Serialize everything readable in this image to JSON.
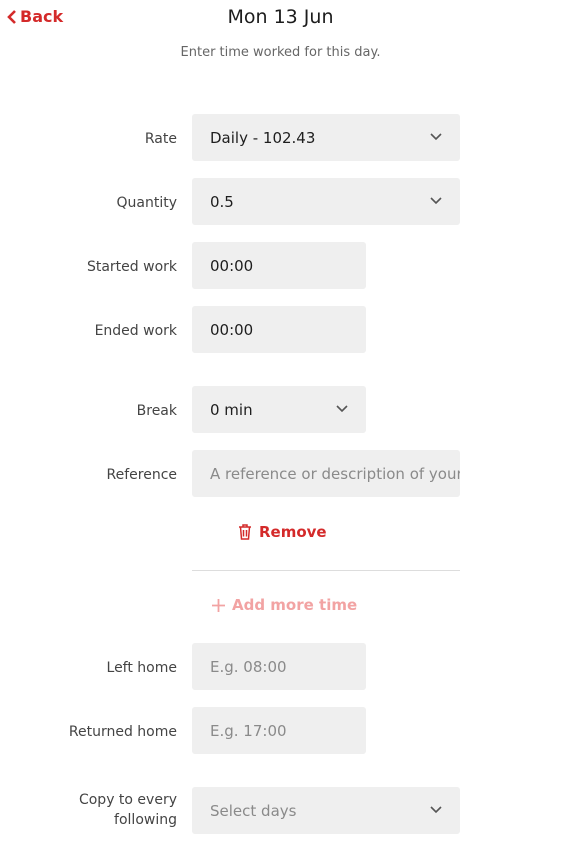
{
  "header": {
    "back_label": "Back",
    "title": "Mon 13 Jun",
    "subtitle": "Enter time worked for this day."
  },
  "form": {
    "rate": {
      "label": "Rate",
      "value": "Daily - 102.43"
    },
    "quantity": {
      "label": "Quantity",
      "value": "0.5"
    },
    "started_work": {
      "label": "Started work",
      "value": "00:00"
    },
    "ended_work": {
      "label": "Ended work",
      "value": "00:00"
    },
    "break": {
      "label": "Break",
      "value": "0 min"
    },
    "reference": {
      "label": "Reference",
      "placeholder": "A reference or description of your"
    },
    "remove_label": "Remove",
    "add_more_label": "Add more time",
    "left_home": {
      "label": "Left home",
      "placeholder": "E.g. 08:00"
    },
    "returned_home": {
      "label": "Returned home",
      "placeholder": "E.g. 17:00"
    },
    "copy_every": {
      "label_line1": "Copy to every",
      "label_line2": "following",
      "placeholder": "Select days"
    }
  },
  "colors": {
    "accent": "#d42a2a",
    "accent_light": "#f2a3a3",
    "field_bg": "#efefef"
  }
}
